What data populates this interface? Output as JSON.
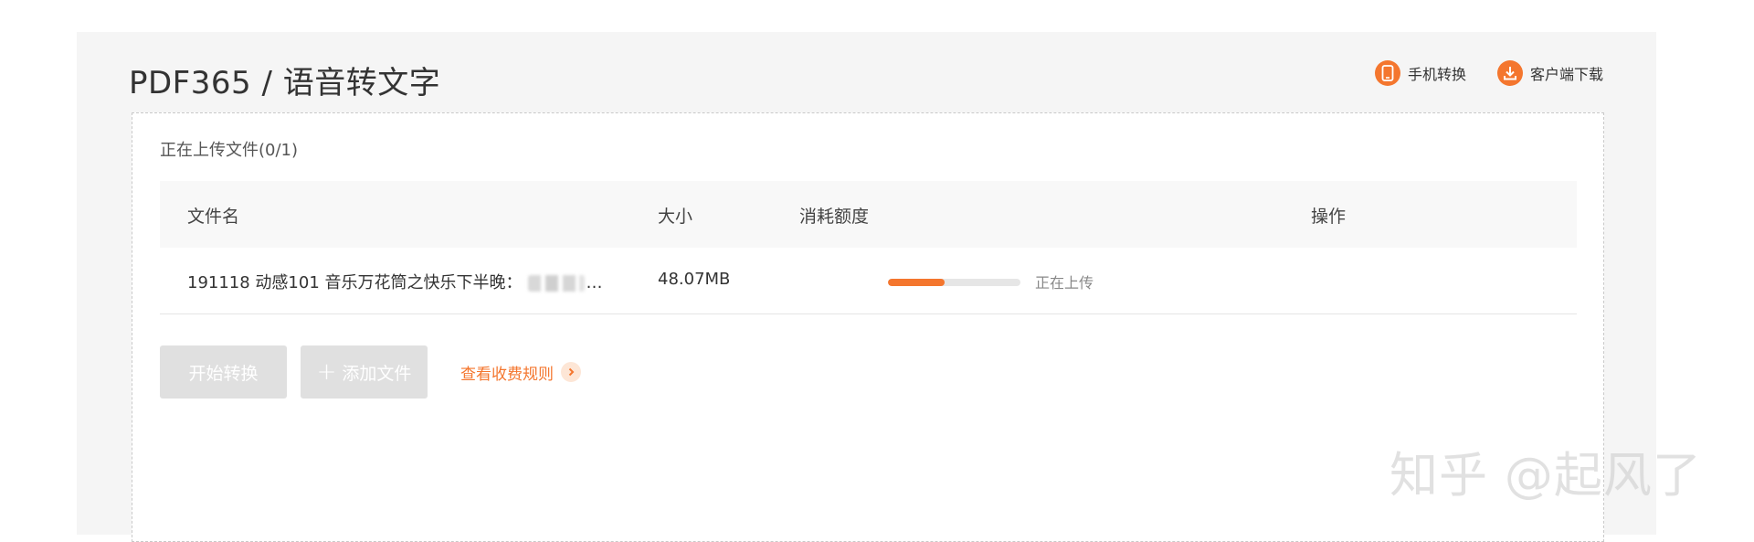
{
  "header": {
    "title": "PDF365 / 语音转文字",
    "links": [
      {
        "label": "手机转换",
        "icon": "phone-icon"
      },
      {
        "label": "客户端下载",
        "icon": "download-icon"
      }
    ]
  },
  "upload": {
    "status": "正在上传文件(0/1)",
    "columns": [
      "文件名",
      "大小",
      "消耗额度",
      "操作"
    ],
    "rows": [
      {
        "filename_prefix": "191118 动感101 音乐万花筒之快乐下半晚：",
        "filename_suffix": "…",
        "size": "48.07MB",
        "progress": 0.43,
        "status": "正在上传"
      }
    ]
  },
  "actions": {
    "start_label": "开始转换",
    "add_label": "添加文件",
    "rules_label": "查看收费规则"
  },
  "watermark": "知乎 @起风了",
  "colors": {
    "accent": "#f4762e",
    "panel_bg": "#f5f5f5",
    "button_disabled": "#e0e0e0"
  }
}
